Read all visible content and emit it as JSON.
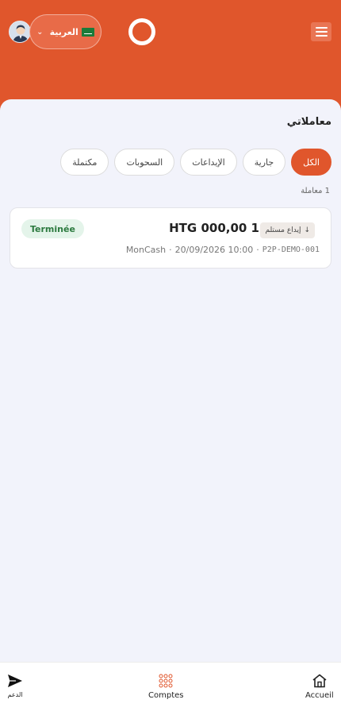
{
  "header": {
    "language": {
      "label": "العربية"
    },
    "icons": {
      "avatar": "user-avatar-icon",
      "flag": "saudi-flag-icon",
      "chevron": "chevron-down-icon",
      "logo": "brand-logo-icon",
      "menu": "hamburger-menu-icon"
    }
  },
  "page": {
    "title": "معاملاتي",
    "tabs": [
      {
        "label": "الكل",
        "active": true
      },
      {
        "label": "جارية",
        "active": false
      },
      {
        "label": "الإيداعات",
        "active": false
      },
      {
        "label": "السحوبات",
        "active": false
      },
      {
        "label": "مكتملة",
        "active": false
      }
    ],
    "count_text": "1 معاملة"
  },
  "transaction": {
    "status": "Terminée",
    "amount": "HTG 000,00 1",
    "type_label": "إيداع مستلم",
    "type_arrow": "↓",
    "method": "MonCash",
    "datetime": "20/09/2026 10:00",
    "reference": "P2P-DEMO-001",
    "separator": "·"
  },
  "bottom_nav": {
    "items": [
      {
        "label": "الدعم",
        "icon": "send-icon"
      },
      {
        "label": "Comptes",
        "icon": "grid-icon"
      },
      {
        "label": "Accueil",
        "icon": "home-icon"
      }
    ]
  },
  "colors": {
    "brand": "#e0562c",
    "background": "#f2f3fb",
    "success_bg": "#e4f4ea",
    "success_text": "#2c7a3f"
  }
}
